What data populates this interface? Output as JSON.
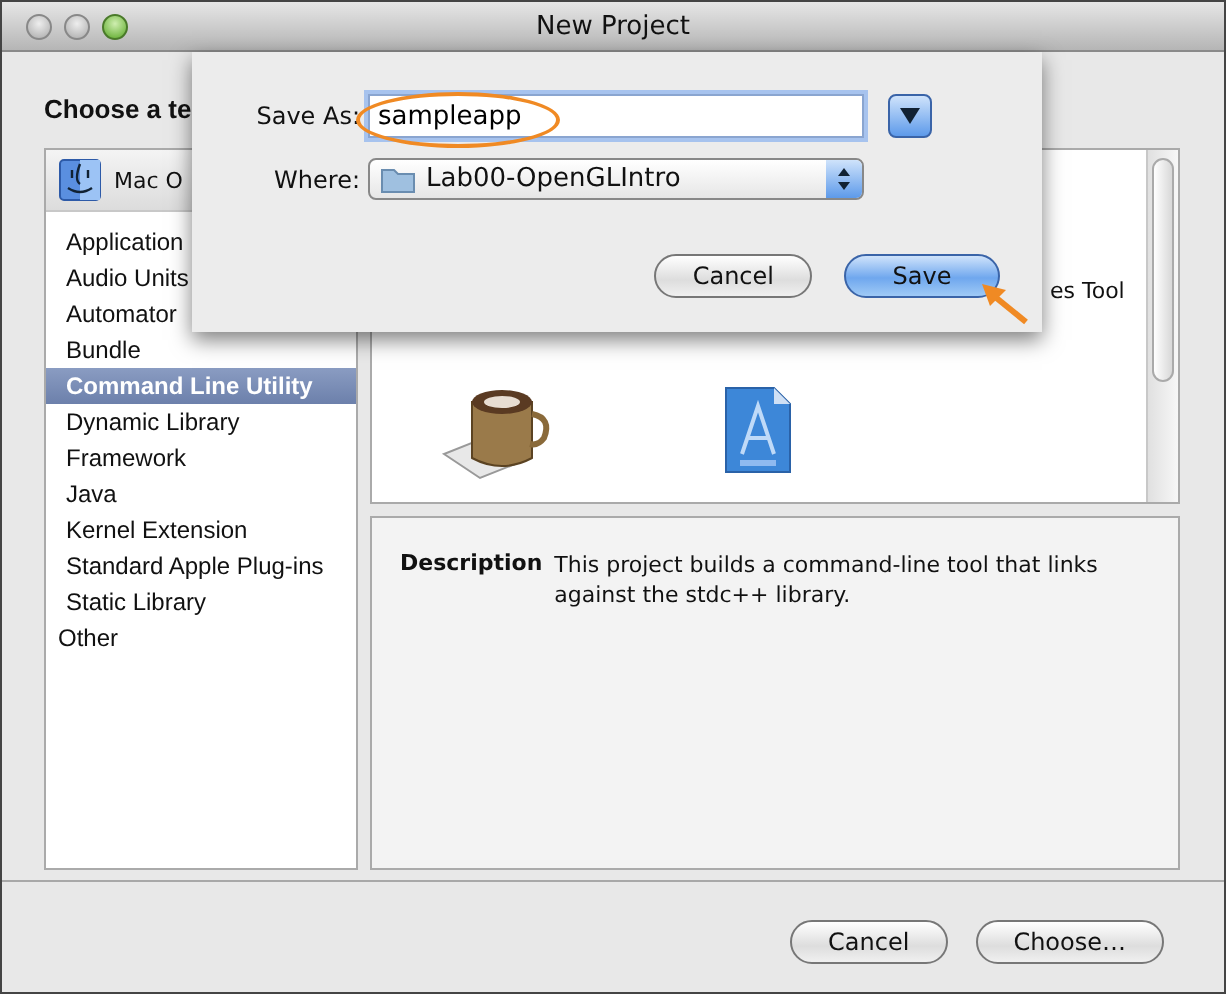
{
  "window": {
    "title": "New Project"
  },
  "heading": "Choose a te",
  "sidebar": {
    "section": {
      "label": "Mac O",
      "items": [
        {
          "label": "Application",
          "selected": false
        },
        {
          "label": "Audio Units",
          "selected": false
        },
        {
          "label": "Automator",
          "selected": false
        },
        {
          "label": "Bundle",
          "selected": false
        },
        {
          "label": "Command Line Utility",
          "selected": true
        },
        {
          "label": "Dynamic Library",
          "selected": false
        },
        {
          "label": "Framework",
          "selected": false
        },
        {
          "label": "Java",
          "selected": false
        },
        {
          "label": "Kernel Extension",
          "selected": false
        },
        {
          "label": "Standard Apple Plug-ins",
          "selected": false
        },
        {
          "label": "Static Library",
          "selected": false
        }
      ]
    },
    "other": {
      "label": "Other",
      "selected": false
    }
  },
  "templates": [
    {
      "label": "es Tool"
    }
  ],
  "description": {
    "label": "Description",
    "text": "This project builds a command-line tool that links against the stdc++ library."
  },
  "buttons": [
    {
      "label": "Cancel",
      "default": false
    },
    {
      "label": "Choose…",
      "default": false
    }
  ],
  "sheet": {
    "save_as": {
      "label": "Save As:",
      "value": "sampleapp"
    },
    "where": {
      "label": "Where:",
      "value": "Lab00-OpenGLIntro"
    },
    "buttons": [
      {
        "label": "Cancel",
        "default": false
      },
      {
        "label": "Save",
        "default": true
      }
    ]
  }
}
